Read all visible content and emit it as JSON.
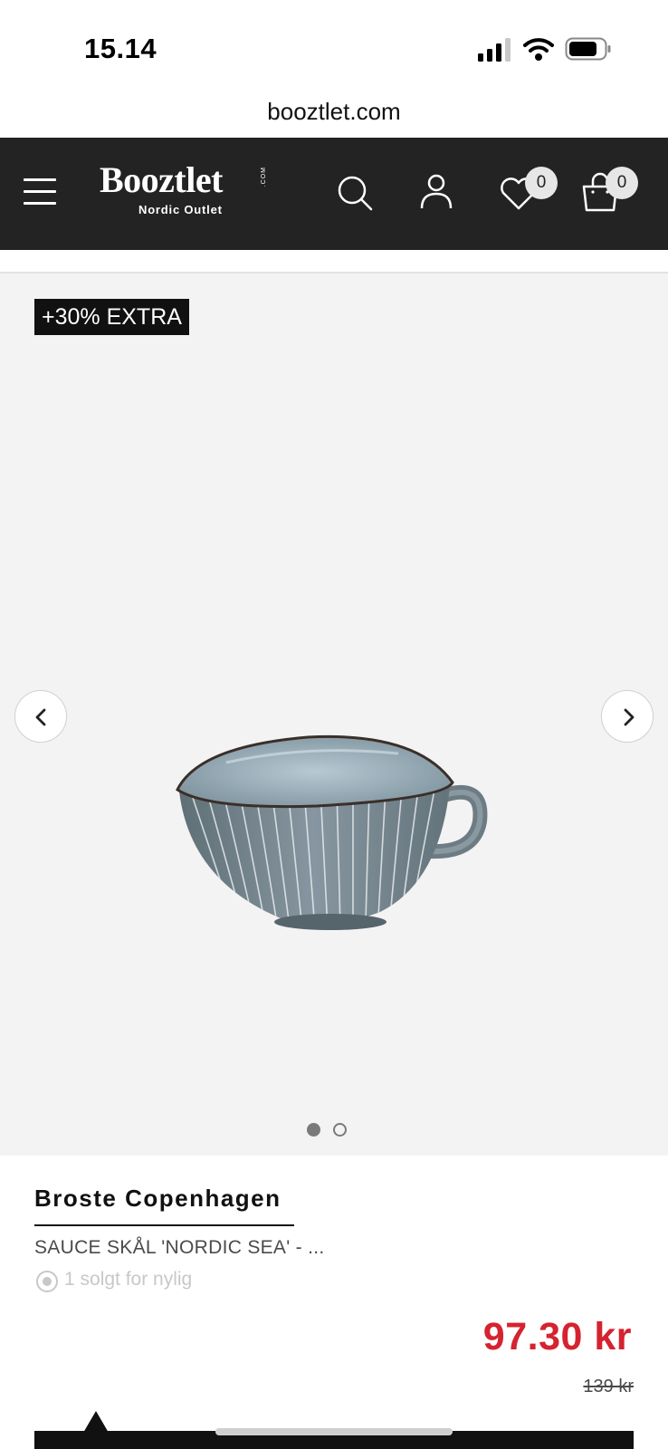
{
  "status_bar": {
    "time": "15.14",
    "signal_icon": "signal-bars-icon",
    "wifi_icon": "wifi-icon",
    "battery_icon": "battery-icon"
  },
  "browser": {
    "url": "booztlet.com"
  },
  "header": {
    "logo_text": "Booztlet",
    "logo_suffix": ".COM",
    "logo_tagline": "Nordic Outlet",
    "background": "#232323",
    "wishlist_count": "0",
    "cart_count": "0"
  },
  "gallery": {
    "promo_badge": "+30% EXTRA",
    "total_images": 2,
    "active_image": 1,
    "background": "#f3f3f3"
  },
  "product": {
    "brand": "Broste Copenhagen",
    "name": "SAUCE SKÅL 'NORDIC SEA' - ...",
    "sold_recently": "1 solgt for nylig",
    "price": "97.30 kr",
    "original_price": "139 kr",
    "price_color": "#d5232f"
  }
}
